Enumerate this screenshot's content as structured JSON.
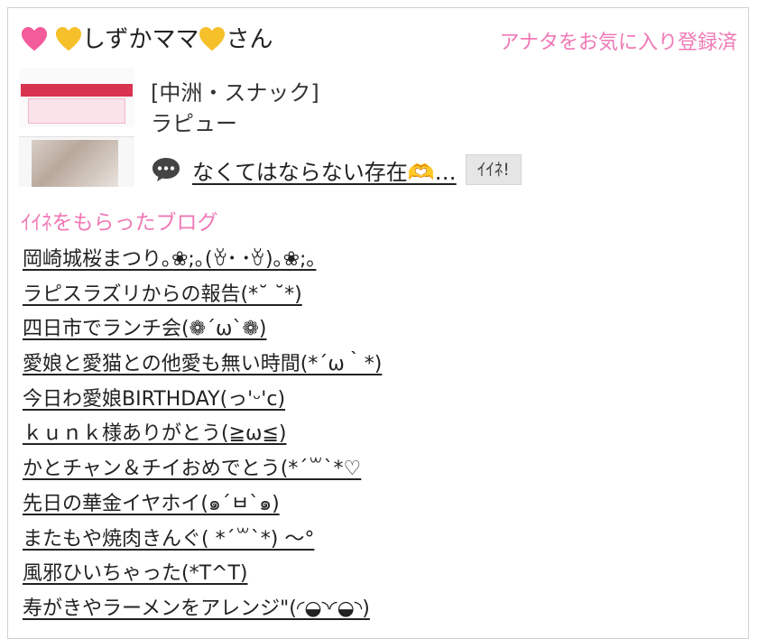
{
  "header": {
    "user_name": "しずかママ",
    "user_suffix": "さん",
    "favorite_status": "アナタをお気に入り登録済"
  },
  "shop": {
    "genre": "[中洲・スナック]",
    "name": "ラピュー"
  },
  "latest_blog": {
    "title": "なくてはならない存在🫶…",
    "like_label": "ｲｲﾈ!"
  },
  "liked_blogs": {
    "section_title": "ｲｲﾈをもらったブログ",
    "items": [
      "岡崎城桜まつり｡❀;｡(ꈊ･ ･ꈊ)｡❀;｡",
      "ラピスラズリからの報告(*˘ ˘*)",
      "四日市でランチ会(❁´ω`❁)",
      "愛娘と愛猫との他愛も無い時間(*´ω｀*)",
      "今日わ愛娘BIRTHDAY(っ'ᵕ'c)",
      "ｋｕｎｋ様ありがとう(≧ω≦)",
      "かとチャン＆チイおめでとう(*´꒳`*♡",
      "先日の華金イヤホイ(๑´ㅂ`๑)",
      "またもや焼肉きんぐ( *´꒳`*) ～°",
      "風邪ひいちゃった(*T^T)",
      "寿がきやラーメンをアレンジ\"(◜◒◝◜◒◝)"
    ]
  },
  "colors": {
    "accent_pink": "#ef79b6",
    "heart_pink": "#f35b9a",
    "heart_gold": "#f6c02b",
    "like_button_bg": "#e6e6e6"
  },
  "icons": {
    "user_prefix": [
      "pink-heart-icon",
      "gold-heart-icon"
    ],
    "user_suffix": "gold-heart-icon",
    "blog": "speech-bubble-icon"
  }
}
